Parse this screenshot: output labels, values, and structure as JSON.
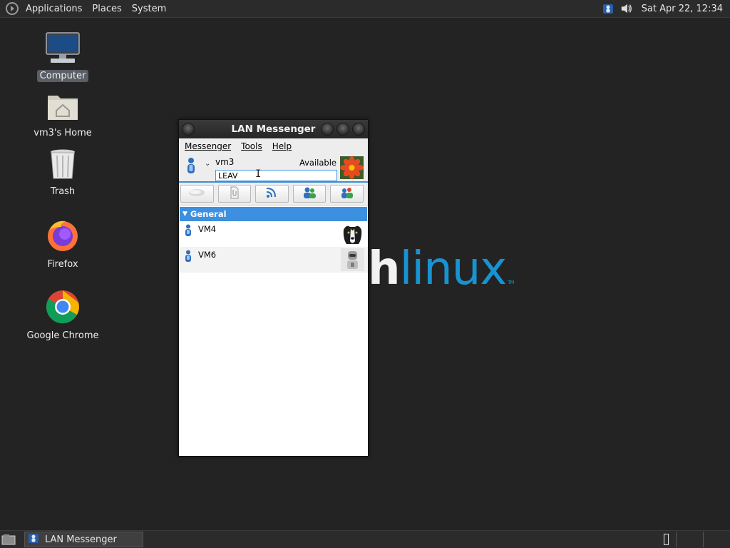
{
  "top_panel": {
    "menus": [
      "Applications",
      "Places",
      "System"
    ],
    "clock": "Sat Apr 22, 12:34",
    "tray_icons": [
      "network-person-icon",
      "volume-icon"
    ]
  },
  "desktop": {
    "icons": [
      {
        "label": "Computer",
        "icon": "computer-icon",
        "selected": true
      },
      {
        "label": "vm3's Home",
        "icon": "home-folder-icon"
      },
      {
        "label": "Trash",
        "icon": "trash-icon"
      },
      {
        "label": "Firefox",
        "icon": "firefox-icon"
      },
      {
        "label": "Google Chrome",
        "icon": "chrome-icon"
      }
    ],
    "wallpaper_text": {
      "part1": "h",
      "part2": "linux",
      "tm": "TM"
    }
  },
  "window": {
    "title": "LAN Messenger",
    "menubar": [
      {
        "label": "Messenger",
        "mnemonic": "M",
        "rest": "essenger"
      },
      {
        "label": "Tools",
        "mnemonic": "T",
        "rest": "ools"
      },
      {
        "label": "Help",
        "mnemonic": "H",
        "rest": "elp"
      }
    ],
    "profile": {
      "name": "vm3",
      "status": "Available",
      "note_value": "LEAV"
    },
    "toolbar": [
      "chat-icon",
      "file-transfer-icon",
      "broadcast-icon",
      "add-contact-icon",
      "contacts-icon"
    ],
    "group": {
      "label": "General"
    },
    "contacts": [
      {
        "name": "VM4",
        "avatar": "dog-avatar-icon"
      },
      {
        "name": "VM6",
        "avatar": "robot-avatar-icon"
      }
    ]
  },
  "bottom_panel": {
    "task": "LAN Messenger"
  },
  "colors": {
    "accent_blue": "#3d8fe0",
    "wallpaper_blue": "#1793d1",
    "panel_bg": "#2b2b2b",
    "desktop_bg": "#232323"
  }
}
